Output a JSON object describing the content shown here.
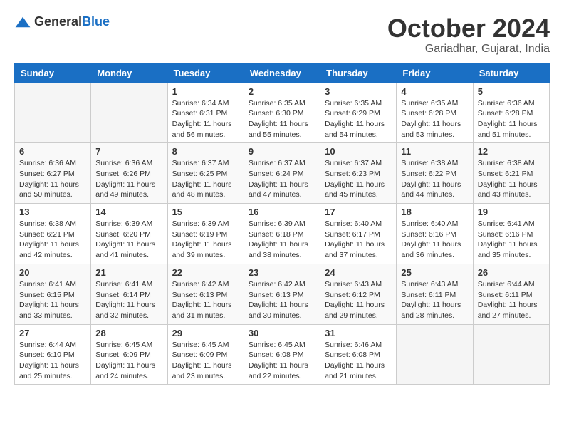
{
  "header": {
    "logo_general": "General",
    "logo_blue": "Blue",
    "month": "October 2024",
    "location": "Gariadhar, Gujarat, India"
  },
  "weekdays": [
    "Sunday",
    "Monday",
    "Tuesday",
    "Wednesday",
    "Thursday",
    "Friday",
    "Saturday"
  ],
  "weeks": [
    [
      null,
      null,
      {
        "day": 1,
        "sunrise": "6:34 AM",
        "sunset": "6:31 PM",
        "daylight": "11 hours and 56 minutes."
      },
      {
        "day": 2,
        "sunrise": "6:35 AM",
        "sunset": "6:30 PM",
        "daylight": "11 hours and 55 minutes."
      },
      {
        "day": 3,
        "sunrise": "6:35 AM",
        "sunset": "6:29 PM",
        "daylight": "11 hours and 54 minutes."
      },
      {
        "day": 4,
        "sunrise": "6:35 AM",
        "sunset": "6:28 PM",
        "daylight": "11 hours and 53 minutes."
      },
      {
        "day": 5,
        "sunrise": "6:36 AM",
        "sunset": "6:28 PM",
        "daylight": "11 hours and 51 minutes."
      }
    ],
    [
      {
        "day": 6,
        "sunrise": "6:36 AM",
        "sunset": "6:27 PM",
        "daylight": "11 hours and 50 minutes."
      },
      {
        "day": 7,
        "sunrise": "6:36 AM",
        "sunset": "6:26 PM",
        "daylight": "11 hours and 49 minutes."
      },
      {
        "day": 8,
        "sunrise": "6:37 AM",
        "sunset": "6:25 PM",
        "daylight": "11 hours and 48 minutes."
      },
      {
        "day": 9,
        "sunrise": "6:37 AM",
        "sunset": "6:24 PM",
        "daylight": "11 hours and 47 minutes."
      },
      {
        "day": 10,
        "sunrise": "6:37 AM",
        "sunset": "6:23 PM",
        "daylight": "11 hours and 45 minutes."
      },
      {
        "day": 11,
        "sunrise": "6:38 AM",
        "sunset": "6:22 PM",
        "daylight": "11 hours and 44 minutes."
      },
      {
        "day": 12,
        "sunrise": "6:38 AM",
        "sunset": "6:21 PM",
        "daylight": "11 hours and 43 minutes."
      }
    ],
    [
      {
        "day": 13,
        "sunrise": "6:38 AM",
        "sunset": "6:21 PM",
        "daylight": "11 hours and 42 minutes."
      },
      {
        "day": 14,
        "sunrise": "6:39 AM",
        "sunset": "6:20 PM",
        "daylight": "11 hours and 41 minutes."
      },
      {
        "day": 15,
        "sunrise": "6:39 AM",
        "sunset": "6:19 PM",
        "daylight": "11 hours and 39 minutes."
      },
      {
        "day": 16,
        "sunrise": "6:39 AM",
        "sunset": "6:18 PM",
        "daylight": "11 hours and 38 minutes."
      },
      {
        "day": 17,
        "sunrise": "6:40 AM",
        "sunset": "6:17 PM",
        "daylight": "11 hours and 37 minutes."
      },
      {
        "day": 18,
        "sunrise": "6:40 AM",
        "sunset": "6:16 PM",
        "daylight": "11 hours and 36 minutes."
      },
      {
        "day": 19,
        "sunrise": "6:41 AM",
        "sunset": "6:16 PM",
        "daylight": "11 hours and 35 minutes."
      }
    ],
    [
      {
        "day": 20,
        "sunrise": "6:41 AM",
        "sunset": "6:15 PM",
        "daylight": "11 hours and 33 minutes."
      },
      {
        "day": 21,
        "sunrise": "6:41 AM",
        "sunset": "6:14 PM",
        "daylight": "11 hours and 32 minutes."
      },
      {
        "day": 22,
        "sunrise": "6:42 AM",
        "sunset": "6:13 PM",
        "daylight": "11 hours and 31 minutes."
      },
      {
        "day": 23,
        "sunrise": "6:42 AM",
        "sunset": "6:13 PM",
        "daylight": "11 hours and 30 minutes."
      },
      {
        "day": 24,
        "sunrise": "6:43 AM",
        "sunset": "6:12 PM",
        "daylight": "11 hours and 29 minutes."
      },
      {
        "day": 25,
        "sunrise": "6:43 AM",
        "sunset": "6:11 PM",
        "daylight": "11 hours and 28 minutes."
      },
      {
        "day": 26,
        "sunrise": "6:44 AM",
        "sunset": "6:11 PM",
        "daylight": "11 hours and 27 minutes."
      }
    ],
    [
      {
        "day": 27,
        "sunrise": "6:44 AM",
        "sunset": "6:10 PM",
        "daylight": "11 hours and 25 minutes."
      },
      {
        "day": 28,
        "sunrise": "6:45 AM",
        "sunset": "6:09 PM",
        "daylight": "11 hours and 24 minutes."
      },
      {
        "day": 29,
        "sunrise": "6:45 AM",
        "sunset": "6:09 PM",
        "daylight": "11 hours and 23 minutes."
      },
      {
        "day": 30,
        "sunrise": "6:45 AM",
        "sunset": "6:08 PM",
        "daylight": "11 hours and 22 minutes."
      },
      {
        "day": 31,
        "sunrise": "6:46 AM",
        "sunset": "6:08 PM",
        "daylight": "11 hours and 21 minutes."
      },
      null,
      null
    ]
  ],
  "labels": {
    "sunrise": "Sunrise:",
    "sunset": "Sunset:",
    "daylight": "Daylight:"
  }
}
